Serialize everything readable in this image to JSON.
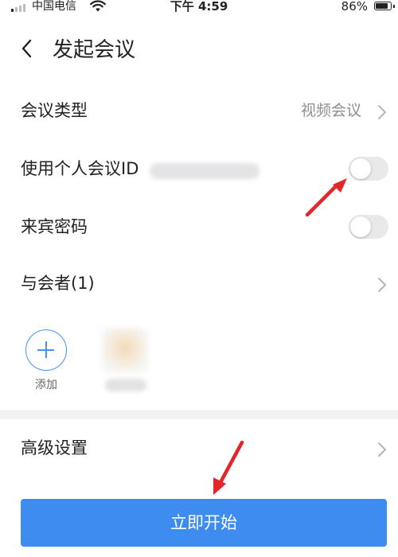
{
  "status_bar": {
    "carrier": "中国电信",
    "time": "下午 4:59",
    "battery_percent": "86%",
    "battery_level": 0.86
  },
  "nav": {
    "title": "发起会议"
  },
  "settings": {
    "meeting_type": {
      "label": "会议类型",
      "value": "视频会议"
    },
    "personal_id": {
      "label": "使用个人会议ID",
      "enabled": false
    },
    "guest_password": {
      "label": "来宾密码",
      "enabled": false
    },
    "participants": {
      "label": "与会者(1)"
    },
    "advanced": {
      "label": "高级设置"
    }
  },
  "participants_area": {
    "add_label": "添加"
  },
  "start_button": {
    "label": "立即开始"
  },
  "colors": {
    "accent": "#3f8cf0",
    "annotation_arrow": "#e3262a",
    "toggle_off": "#e9e9ea",
    "secondary_text": "#8e8e93"
  },
  "icons": [
    "signal-icon",
    "wifi-icon",
    "battery-icon",
    "back-icon",
    "chevron-right-icon",
    "plus-icon",
    "annotation-arrow-icon"
  ]
}
